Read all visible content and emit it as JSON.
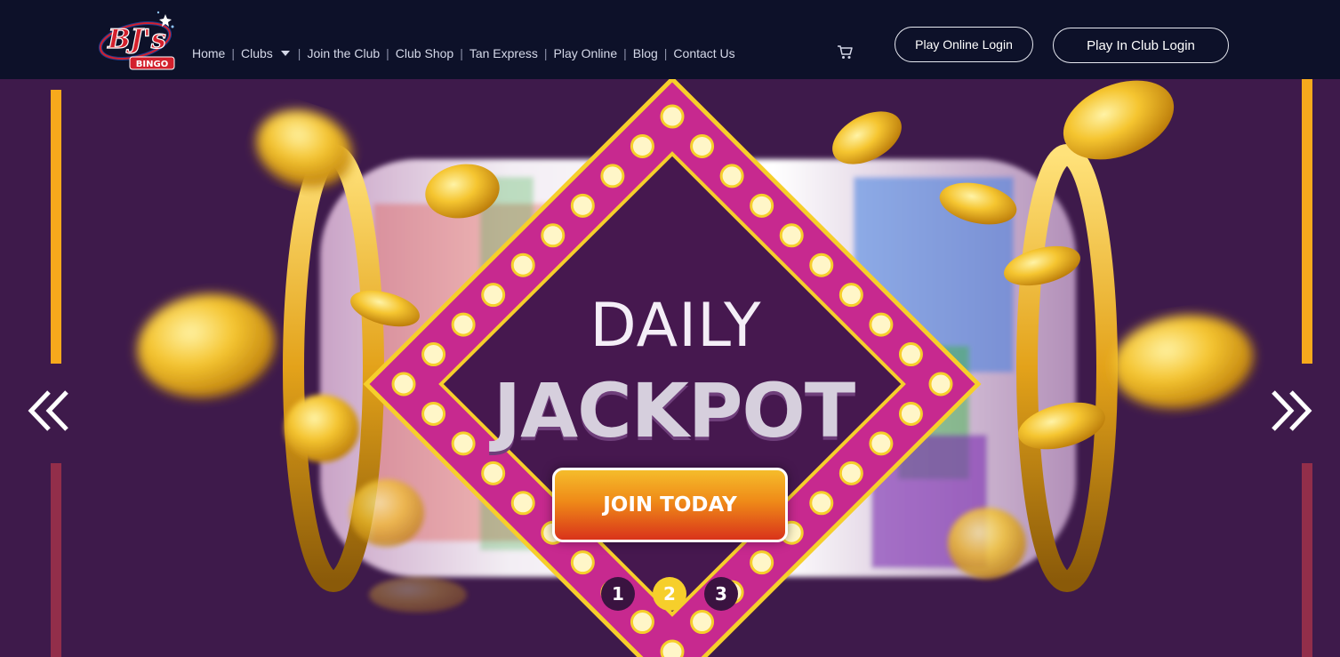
{
  "header": {
    "logo_text": "BJ's",
    "logo_sub": "BINGO",
    "nav": [
      {
        "label": "Home"
      },
      {
        "label": "Clubs",
        "has_dropdown": true
      },
      {
        "label": "Join the Club"
      },
      {
        "label": "Club Shop"
      },
      {
        "label": "Tan Express"
      },
      {
        "label": "Play Online"
      },
      {
        "label": "Blog"
      },
      {
        "label": "Contact Us"
      }
    ],
    "separator": "|",
    "cart_icon": "cart-icon",
    "play_online_login": "Play Online Login",
    "play_in_club_login": "Play In Club Login"
  },
  "hero": {
    "line1": "DAILY",
    "line2": "JACKPOT",
    "cta": "JOIN TODAY",
    "prev_icon": "double-chevron-left-icon",
    "next_icon": "double-chevron-right-icon",
    "slides": [
      "1",
      "2",
      "3"
    ],
    "active_slide": 2
  },
  "colors": {
    "header_bg": "#0d1129",
    "hero_bg": "#3e1a4b",
    "accent_gold": "#f6cf2b",
    "marquee_pink": "#c7298f",
    "cta_top": "#f5bc2b",
    "cta_bottom": "#d9331a"
  }
}
